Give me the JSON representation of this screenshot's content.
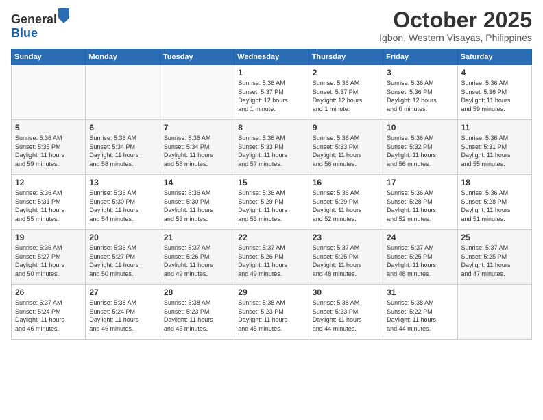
{
  "logo": {
    "general": "General",
    "blue": "Blue"
  },
  "header": {
    "month": "October 2025",
    "location": "Igbon, Western Visayas, Philippines"
  },
  "weekdays": [
    "Sunday",
    "Monday",
    "Tuesday",
    "Wednesday",
    "Thursday",
    "Friday",
    "Saturday"
  ],
  "weeks": [
    [
      {
        "day": "",
        "text": ""
      },
      {
        "day": "",
        "text": ""
      },
      {
        "day": "",
        "text": ""
      },
      {
        "day": "1",
        "text": "Sunrise: 5:36 AM\nSunset: 5:37 PM\nDaylight: 12 hours\nand 1 minute."
      },
      {
        "day": "2",
        "text": "Sunrise: 5:36 AM\nSunset: 5:37 PM\nDaylight: 12 hours\nand 1 minute."
      },
      {
        "day": "3",
        "text": "Sunrise: 5:36 AM\nSunset: 5:36 PM\nDaylight: 12 hours\nand 0 minutes."
      },
      {
        "day": "4",
        "text": "Sunrise: 5:36 AM\nSunset: 5:36 PM\nDaylight: 11 hours\nand 59 minutes."
      }
    ],
    [
      {
        "day": "5",
        "text": "Sunrise: 5:36 AM\nSunset: 5:35 PM\nDaylight: 11 hours\nand 59 minutes."
      },
      {
        "day": "6",
        "text": "Sunrise: 5:36 AM\nSunset: 5:34 PM\nDaylight: 11 hours\nand 58 minutes."
      },
      {
        "day": "7",
        "text": "Sunrise: 5:36 AM\nSunset: 5:34 PM\nDaylight: 11 hours\nand 58 minutes."
      },
      {
        "day": "8",
        "text": "Sunrise: 5:36 AM\nSunset: 5:33 PM\nDaylight: 11 hours\nand 57 minutes."
      },
      {
        "day": "9",
        "text": "Sunrise: 5:36 AM\nSunset: 5:33 PM\nDaylight: 11 hours\nand 56 minutes."
      },
      {
        "day": "10",
        "text": "Sunrise: 5:36 AM\nSunset: 5:32 PM\nDaylight: 11 hours\nand 56 minutes."
      },
      {
        "day": "11",
        "text": "Sunrise: 5:36 AM\nSunset: 5:31 PM\nDaylight: 11 hours\nand 55 minutes."
      }
    ],
    [
      {
        "day": "12",
        "text": "Sunrise: 5:36 AM\nSunset: 5:31 PM\nDaylight: 11 hours\nand 55 minutes."
      },
      {
        "day": "13",
        "text": "Sunrise: 5:36 AM\nSunset: 5:30 PM\nDaylight: 11 hours\nand 54 minutes."
      },
      {
        "day": "14",
        "text": "Sunrise: 5:36 AM\nSunset: 5:30 PM\nDaylight: 11 hours\nand 53 minutes."
      },
      {
        "day": "15",
        "text": "Sunrise: 5:36 AM\nSunset: 5:29 PM\nDaylight: 11 hours\nand 53 minutes."
      },
      {
        "day": "16",
        "text": "Sunrise: 5:36 AM\nSunset: 5:29 PM\nDaylight: 11 hours\nand 52 minutes."
      },
      {
        "day": "17",
        "text": "Sunrise: 5:36 AM\nSunset: 5:28 PM\nDaylight: 11 hours\nand 52 minutes."
      },
      {
        "day": "18",
        "text": "Sunrise: 5:36 AM\nSunset: 5:28 PM\nDaylight: 11 hours\nand 51 minutes."
      }
    ],
    [
      {
        "day": "19",
        "text": "Sunrise: 5:36 AM\nSunset: 5:27 PM\nDaylight: 11 hours\nand 50 minutes."
      },
      {
        "day": "20",
        "text": "Sunrise: 5:36 AM\nSunset: 5:27 PM\nDaylight: 11 hours\nand 50 minutes."
      },
      {
        "day": "21",
        "text": "Sunrise: 5:37 AM\nSunset: 5:26 PM\nDaylight: 11 hours\nand 49 minutes."
      },
      {
        "day": "22",
        "text": "Sunrise: 5:37 AM\nSunset: 5:26 PM\nDaylight: 11 hours\nand 49 minutes."
      },
      {
        "day": "23",
        "text": "Sunrise: 5:37 AM\nSunset: 5:25 PM\nDaylight: 11 hours\nand 48 minutes."
      },
      {
        "day": "24",
        "text": "Sunrise: 5:37 AM\nSunset: 5:25 PM\nDaylight: 11 hours\nand 48 minutes."
      },
      {
        "day": "25",
        "text": "Sunrise: 5:37 AM\nSunset: 5:25 PM\nDaylight: 11 hours\nand 47 minutes."
      }
    ],
    [
      {
        "day": "26",
        "text": "Sunrise: 5:37 AM\nSunset: 5:24 PM\nDaylight: 11 hours\nand 46 minutes."
      },
      {
        "day": "27",
        "text": "Sunrise: 5:38 AM\nSunset: 5:24 PM\nDaylight: 11 hours\nand 46 minutes."
      },
      {
        "day": "28",
        "text": "Sunrise: 5:38 AM\nSunset: 5:23 PM\nDaylight: 11 hours\nand 45 minutes."
      },
      {
        "day": "29",
        "text": "Sunrise: 5:38 AM\nSunset: 5:23 PM\nDaylight: 11 hours\nand 45 minutes."
      },
      {
        "day": "30",
        "text": "Sunrise: 5:38 AM\nSunset: 5:23 PM\nDaylight: 11 hours\nand 44 minutes."
      },
      {
        "day": "31",
        "text": "Sunrise: 5:38 AM\nSunset: 5:22 PM\nDaylight: 11 hours\nand 44 minutes."
      },
      {
        "day": "",
        "text": ""
      }
    ]
  ]
}
